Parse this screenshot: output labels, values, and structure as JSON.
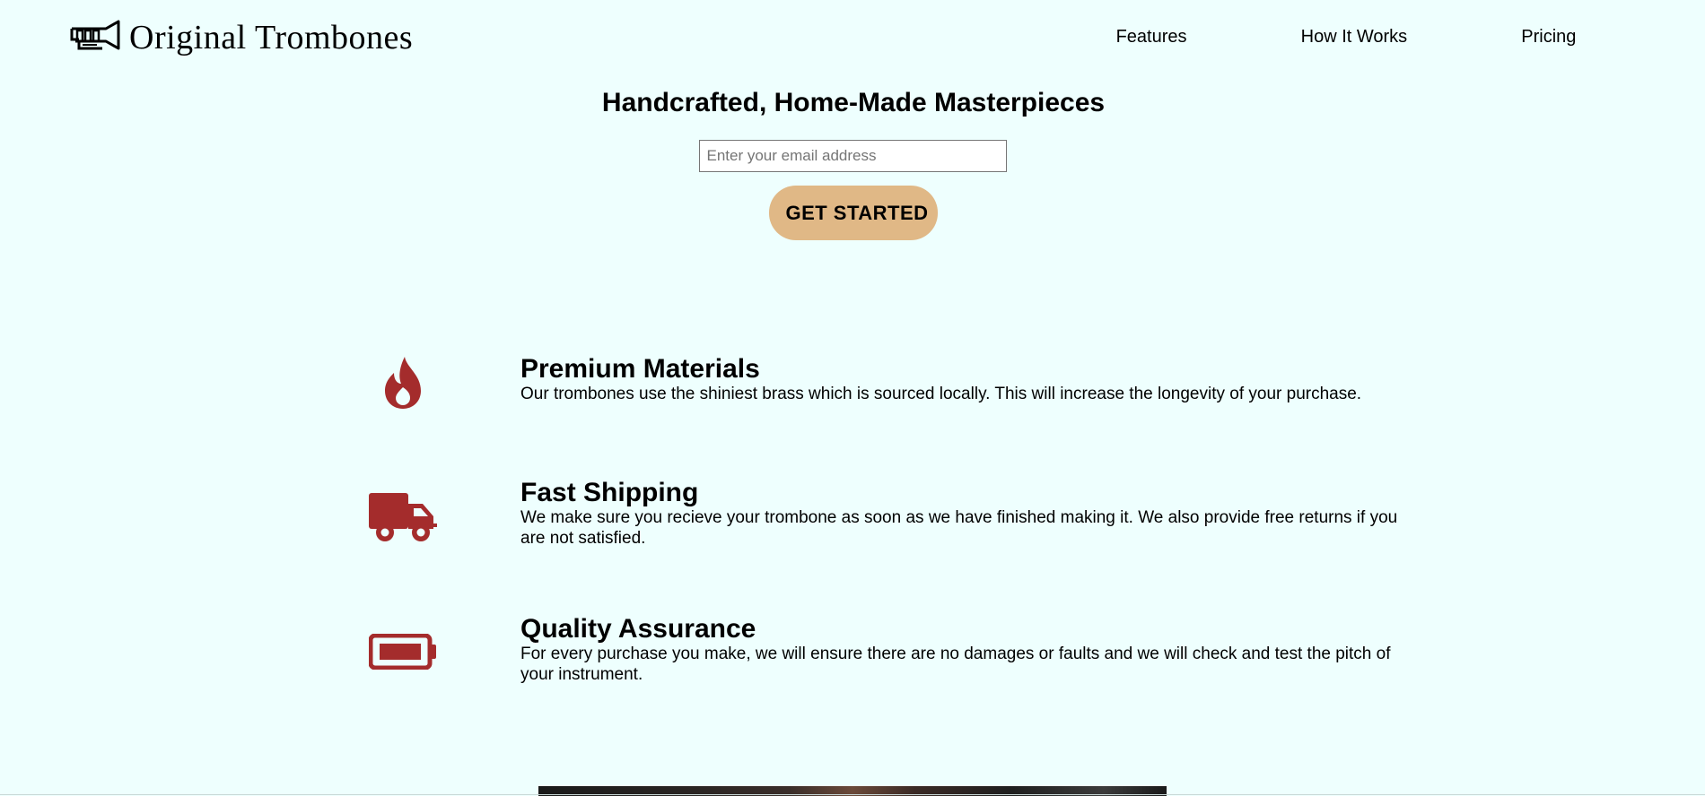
{
  "brand": {
    "name": "Original Trombones",
    "logo_icon": "trombone-logo-icon"
  },
  "nav": {
    "items": [
      {
        "label": "Features"
      },
      {
        "label": "How It Works"
      },
      {
        "label": "Pricing"
      }
    ]
  },
  "hero": {
    "title": "Handcrafted, Home-Made Masterpieces",
    "email_placeholder": "Enter your email address",
    "email_value": "",
    "cta_label": "GET STARTED"
  },
  "features": [
    {
      "icon": "fire-icon",
      "title": "Premium Materials",
      "description": "Our trombones use the shiniest brass which is sourced locally. This will increase the longevity of your purchase."
    },
    {
      "icon": "truck-icon",
      "title": "Fast Shipping",
      "description": "We make sure you recieve your trombone as soon as we have finished making it. We also provide free returns if you are not satisfied."
    },
    {
      "icon": "battery-full-icon",
      "title": "Quality Assurance",
      "description": "For every purchase you make, we will ensure there are no damages or faults and we will check and test the pitch of your instrument."
    }
  ],
  "colors": {
    "background": "#eefffe",
    "accent_icon": "#a42c2c",
    "cta_background": "#e0b886"
  }
}
